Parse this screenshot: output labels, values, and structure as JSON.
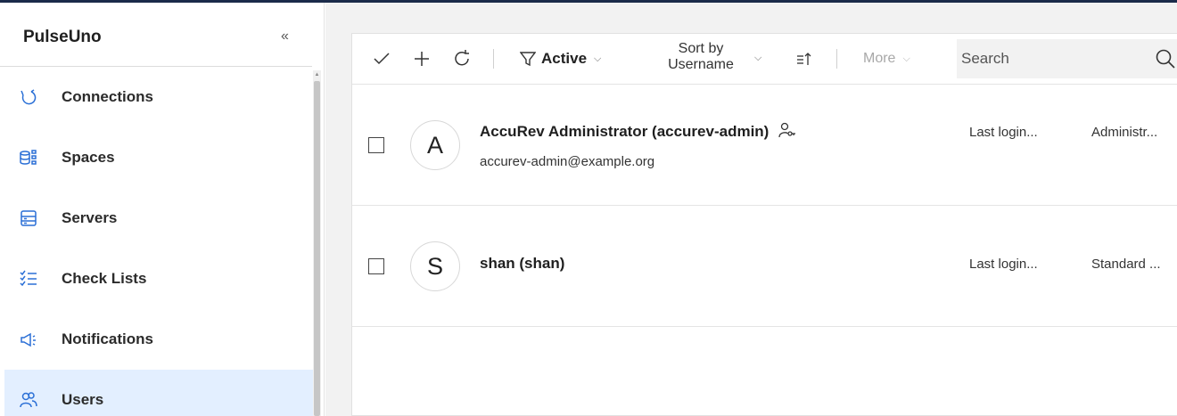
{
  "app": {
    "title": "PulseUno",
    "collapse_glyph": "«"
  },
  "sidebar": {
    "items": [
      {
        "label": "Connections",
        "icon": "connections-icon",
        "active": false
      },
      {
        "label": "Spaces",
        "icon": "spaces-icon",
        "active": false
      },
      {
        "label": "Servers",
        "icon": "servers-icon",
        "active": false
      },
      {
        "label": "Check Lists",
        "icon": "checklist-icon",
        "active": false
      },
      {
        "label": "Notifications",
        "icon": "megaphone-icon",
        "active": false
      },
      {
        "label": "Users",
        "icon": "users-icon",
        "active": true
      }
    ]
  },
  "toolbar": {
    "filter_label": "Active",
    "sort_line1": "Sort by",
    "sort_line2": "Username",
    "more_label": "More",
    "search_placeholder": "Search"
  },
  "users": [
    {
      "initial": "A",
      "name": "AccuRev Administrator (accurev-admin)",
      "email": "accurev-admin@example.org",
      "last_login": "Last login...",
      "role": "Administr...",
      "is_admin": true
    },
    {
      "initial": "S",
      "name": "shan (shan)",
      "email": "",
      "last_login": "Last login...",
      "role": "Standard ...",
      "is_admin": false
    }
  ],
  "colors": {
    "accent": "#e3efff",
    "topline": "#1b2b4a",
    "panel_bg": "#f2f2f2"
  }
}
